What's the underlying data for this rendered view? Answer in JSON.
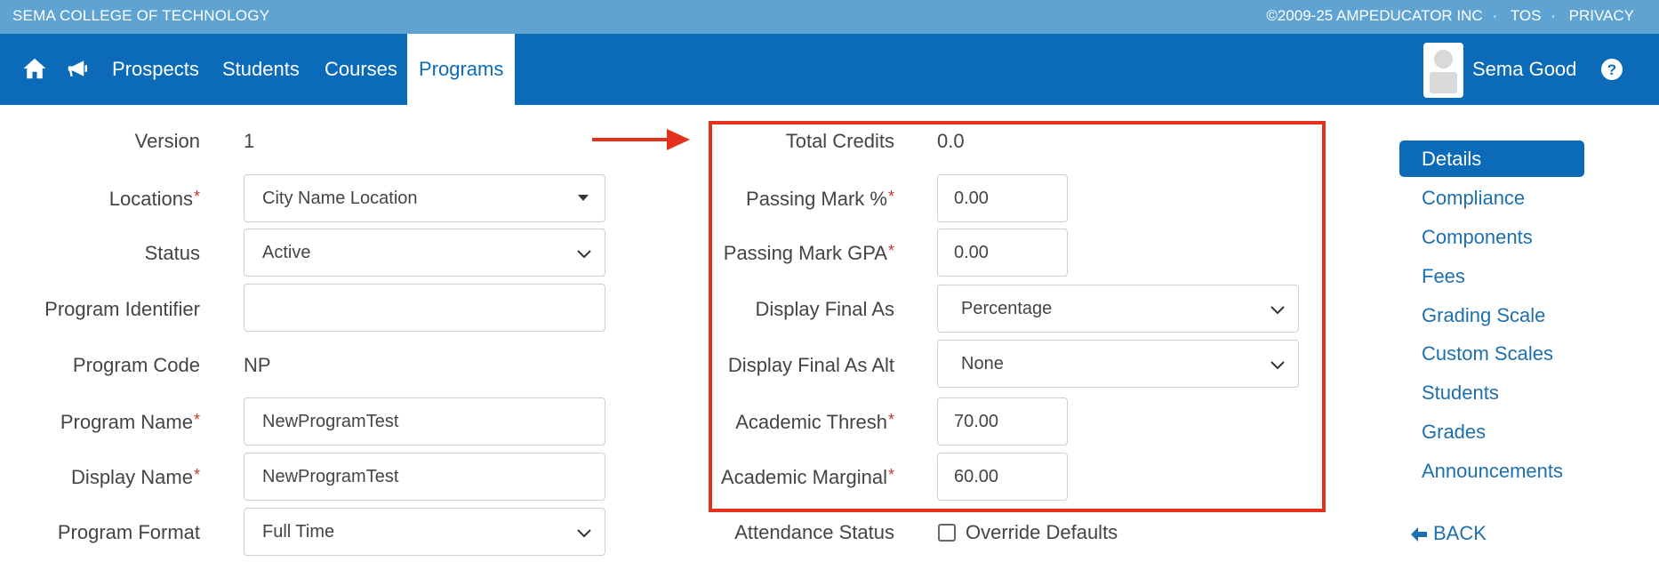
{
  "topbar": {
    "school": "SEMA COLLEGE OF TECHNOLOGY",
    "copyright": "©2009-25 AMPEDUCATOR INC",
    "tos": "TOS",
    "privacy": "PRIVACY",
    "separator": "·"
  },
  "nav": {
    "items": [
      "Prospects",
      "Students",
      "Courses",
      "Programs"
    ],
    "active": "Programs",
    "user": "Sema Good",
    "icons": [
      "home-icon",
      "megaphone-icon",
      "help-icon"
    ]
  },
  "left_form": {
    "version_label": "Version",
    "version_value": "1",
    "locations_label": "Locations",
    "locations_value": "City Name Location",
    "status_label": "Status",
    "status_value": "Active",
    "identifier_label": "Program Identifier",
    "identifier_value": "",
    "code_label": "Program Code",
    "code_value": "NP",
    "name_label": "Program Name",
    "name_value": "NewProgramTest",
    "display_label": "Display Name",
    "display_value": "NewProgramTest",
    "format_label": "Program Format",
    "format_value": "Full Time",
    "required_mark": "*"
  },
  "right_form": {
    "credits_label": "Total Credits",
    "credits_value": "0.0",
    "pass_pct_label": "Passing Mark %",
    "pass_pct_value": "0.00",
    "pass_gpa_label": "Passing Mark GPA",
    "pass_gpa_value": "0.00",
    "final_label": "Display Final As",
    "final_value": "Percentage",
    "final_alt_label": "Display Final As Alt",
    "final_alt_value": "None",
    "thresh_label": "Academic Thresh",
    "thresh_value": "70.00",
    "marginal_label": "Academic Marginal",
    "marginal_value": "60.00",
    "attendance_label": "Attendance Status",
    "override_label": "Override Defaults",
    "override_checked": false
  },
  "side_nav": {
    "items": [
      "Details",
      "Compliance",
      "Components",
      "Fees",
      "Grading Scale",
      "Custom Scales",
      "Students",
      "Grades",
      "Announcements"
    ],
    "active": "Details",
    "back": "BACK"
  },
  "colors": {
    "topbar": "#5fa3d3",
    "nav": "#0b6bb8",
    "link": "#1d6fae",
    "highlight": "#e2321b",
    "required": "#c0392b"
  }
}
